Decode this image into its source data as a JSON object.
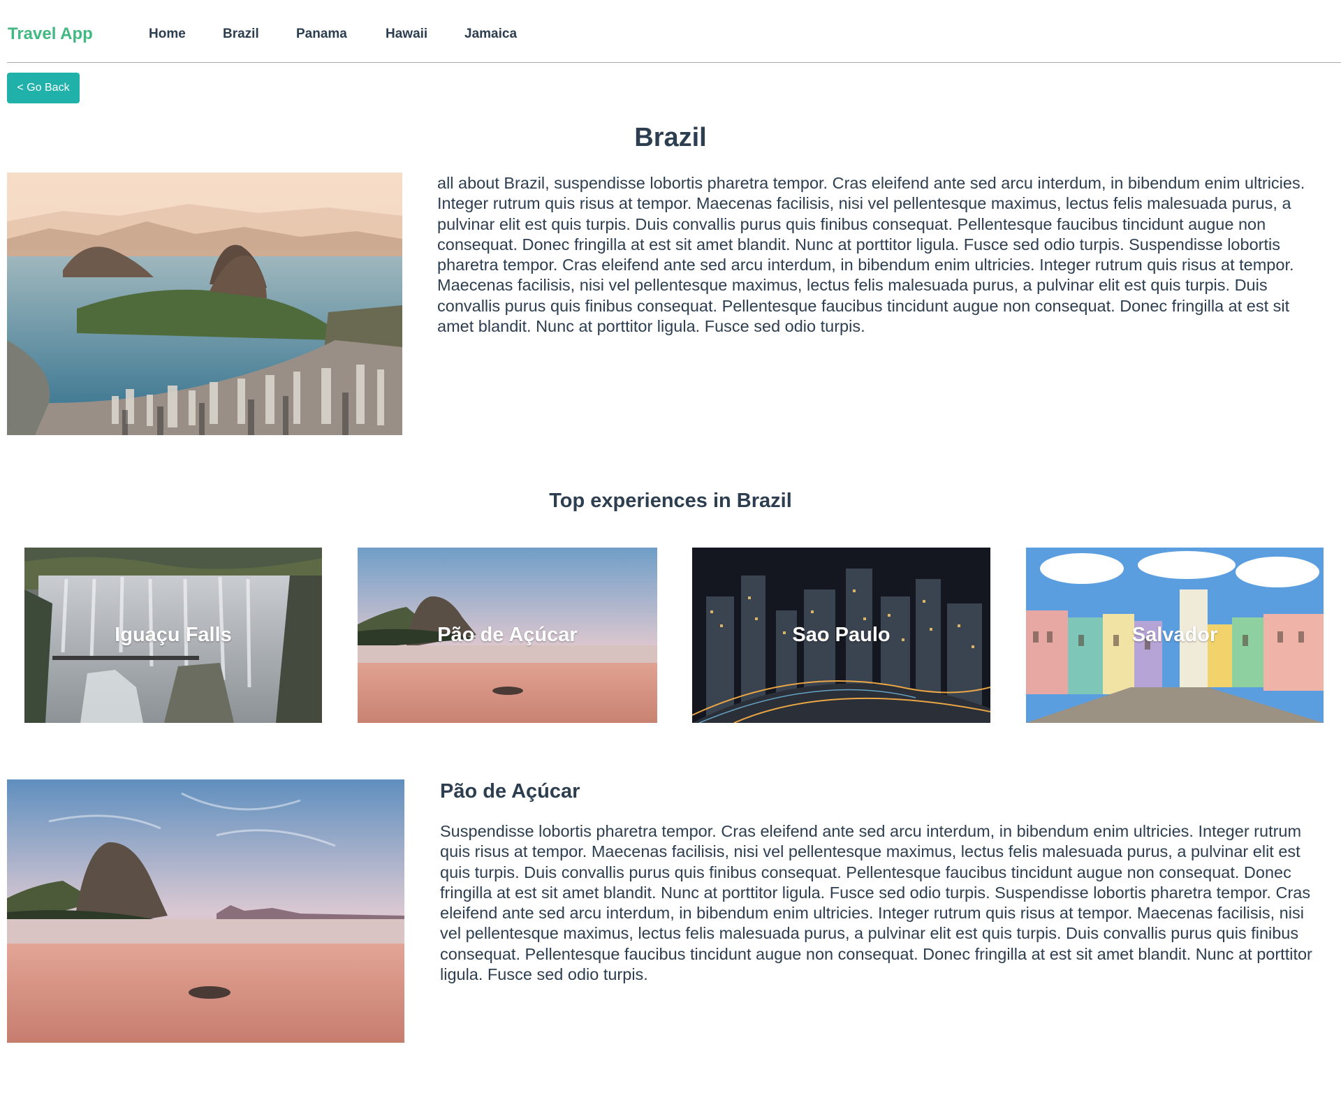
{
  "navbar": {
    "brand": "Travel App",
    "links": [
      "Home",
      "Brazil",
      "Panama",
      "Hawaii",
      "Jamaica"
    ]
  },
  "go_back_label": "< Go Back",
  "destination": {
    "title": "Brazil",
    "description": "all about Brazil, suspendisse lobortis pharetra tempor. Cras eleifend ante sed arcu interdum, in bibendum enim ultricies. Integer rutrum quis risus at tempor. Maecenas facilisis, nisi vel pellentesque maximus, lectus felis malesuada purus, a pulvinar elit est quis turpis. Duis convallis purus quis finibus consequat. Pellentesque faucibus tincidunt augue non consequat. Donec fringilla at est sit amet blandit. Nunc at porttitor ligula. Fusce sed odio turpis. Suspendisse lobortis pharetra tempor. Cras eleifend ante sed arcu interdum, in bibendum enim ultricies. Integer rutrum quis risus at tempor. Maecenas facilisis, nisi vel pellentesque maximus, lectus felis malesuada purus, a pulvinar elit est quis turpis. Duis convallis purus quis finibus consequat. Pellentesque faucibus tincidunt augue non consequat. Donec fringilla at est sit amet blandit. Nunc at porttitor ligula. Fusce sed odio turpis."
  },
  "experiences": {
    "heading": "Top experiences in Brazil",
    "cards": [
      {
        "name": "Iguaçu Falls"
      },
      {
        "name": "Pão de Açúcar"
      },
      {
        "name": "Sao Paulo"
      },
      {
        "name": "Salvador"
      }
    ]
  },
  "detail": {
    "title": "Pão de Açúcar",
    "description": "Suspendisse lobortis pharetra tempor. Cras eleifend ante sed arcu interdum, in bibendum enim ultricies. Integer rutrum quis risus at tempor. Maecenas facilisis, nisi vel pellentesque maximus, lectus felis malesuada purus, a pulvinar elit est quis turpis. Duis convallis purus quis finibus consequat. Pellentesque faucibus tincidunt augue non consequat. Donec fringilla at est sit amet blandit. Nunc at porttitor ligula. Fusce sed odio turpis. Suspendisse lobortis pharetra tempor. Cras eleifend ante sed arcu interdum, in bibendum enim ultricies. Integer rutrum quis risus at tempor. Maecenas facilisis, nisi vel pellentesque maximus, lectus felis malesuada purus, a pulvinar elit est quis turpis. Duis convallis purus quis finibus consequat. Pellentesque faucibus tincidunt augue non consequat. Donec fringilla at est sit amet blandit. Nunc at porttitor ligula. Fusce sed odio turpis."
  },
  "colors": {
    "brand": "#42b983",
    "button": "#20b2aa",
    "text": "#2c3e50",
    "divider": "#a9a9a9"
  }
}
